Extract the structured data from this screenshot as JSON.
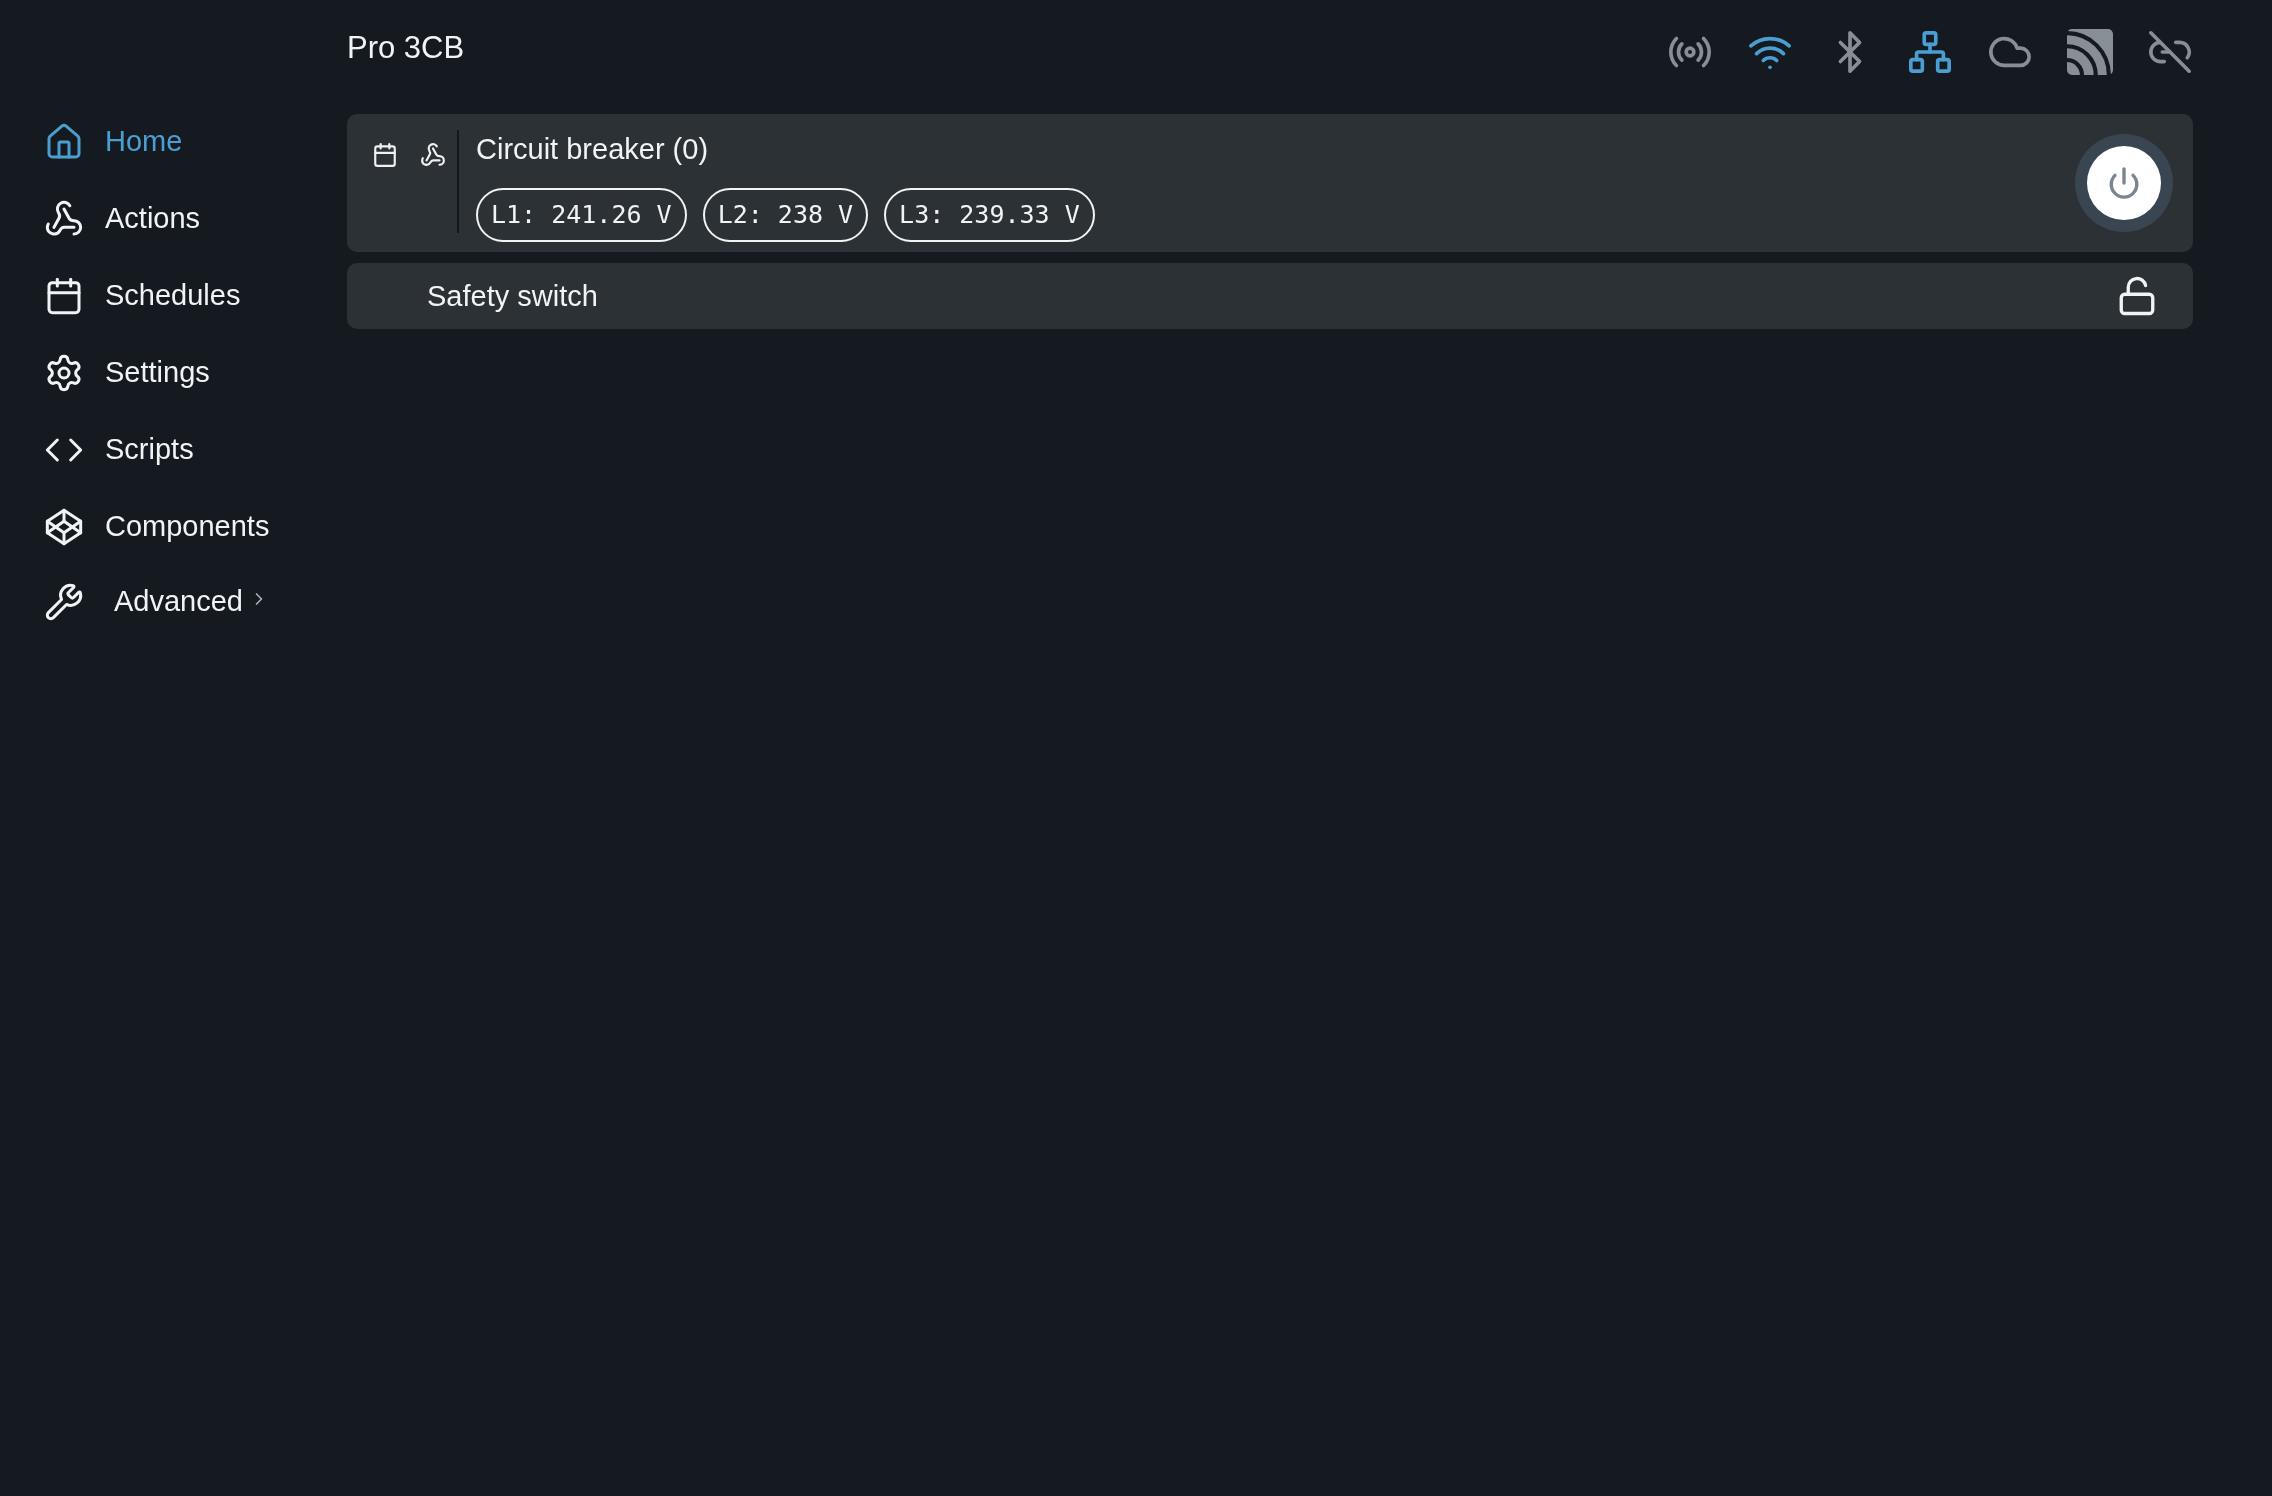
{
  "header": {
    "title": "Pro 3CB",
    "status_icons": [
      {
        "kind": "ap",
        "active": false
      },
      {
        "kind": "wifi",
        "active": true
      },
      {
        "kind": "bluetooth",
        "active": false
      },
      {
        "kind": "ethernet",
        "active": true
      },
      {
        "kind": "cloud",
        "active": false
      },
      {
        "kind": "mqtt",
        "active": false
      },
      {
        "kind": "websocket",
        "active": false
      }
    ]
  },
  "sidebar": {
    "items": [
      {
        "label": "Home",
        "selected": true
      },
      {
        "label": "Actions",
        "selected": false
      },
      {
        "label": "Schedules",
        "selected": false
      },
      {
        "label": "Settings",
        "selected": false
      },
      {
        "label": "Scripts",
        "selected": false
      },
      {
        "label": "Components",
        "selected": false
      }
    ],
    "advanced": {
      "label": "Advanced",
      "expanded": false
    }
  },
  "components": [
    {
      "kind": "switch",
      "title": "Circuit breaker (0)",
      "readings": [
        "L1: 241.26 V",
        "L2: 238 V",
        "L3: 239.33 V"
      ],
      "on": false
    },
    {
      "kind": "lock",
      "title": "Safety switch",
      "locked": false
    }
  ]
}
